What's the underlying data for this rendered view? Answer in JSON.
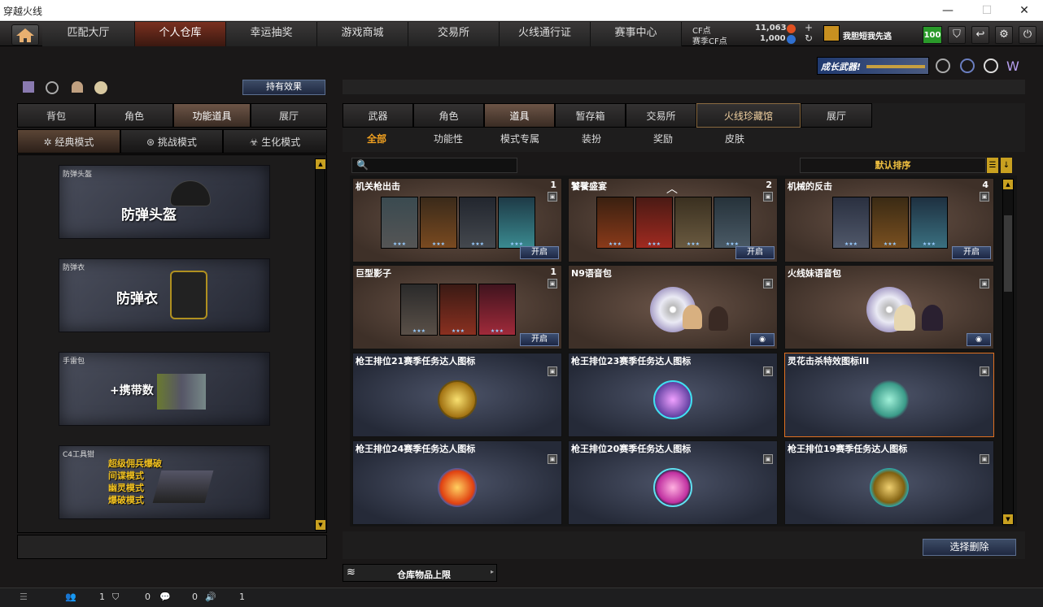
{
  "window": {
    "title": "穿越火线",
    "min": "—",
    "max": "☐",
    "close": "✕"
  },
  "nav": {
    "tabs": [
      "匹配大厅",
      "个人仓库",
      "幸运抽奖",
      "游戏商城",
      "交易所",
      "火线通行证",
      "赛事中心"
    ],
    "active_index": 1
  },
  "currency": {
    "cf_label": "CF点",
    "cf_value": "11,063",
    "season_label": "赛季CF点",
    "season_value": "1,000"
  },
  "user": {
    "name": "我胆短我先逃",
    "level": "100"
  },
  "banner": {
    "text": "成长武器!"
  },
  "left": {
    "effects_button": "持有效果",
    "tabs": [
      "背包",
      "角色",
      "功能道具",
      "展厅"
    ],
    "active_tab": 2,
    "modes": [
      "经典模式",
      "挑战模式",
      "生化模式"
    ],
    "active_mode": 0,
    "slots": [
      {
        "label": "防弹头盔",
        "title": "防弹头盔"
      },
      {
        "label": "防弹衣",
        "title": "防弹衣"
      },
      {
        "label": "手雷包",
        "title": "+携带数"
      },
      {
        "label": "C4工具钳",
        "lines": [
          "超级佣兵爆破",
          "间谍模式",
          "幽灵模式",
          "爆破模式"
        ]
      }
    ]
  },
  "right": {
    "tabs": [
      "武器",
      "角色",
      "道具",
      "暂存箱",
      "交易所",
      "火线珍藏馆",
      "展厅"
    ],
    "active_tab": 2,
    "subtabs": [
      "全部",
      "功能性",
      "模式专属",
      "装扮",
      "奖励",
      "皮肤"
    ],
    "active_sub": 0,
    "search_placeholder": "",
    "sort": "默认排序",
    "cards": [
      {
        "name": "机关枪出击",
        "count": "1",
        "button": "开启"
      },
      {
        "name": "饕餮盛宴",
        "count": "2",
        "button": "开启"
      },
      {
        "name": "机械的反击",
        "count": "4",
        "button": "开启"
      },
      {
        "name": "巨型影子",
        "count": "1",
        "button": "开启"
      },
      {
        "name": "N9语音包",
        "count": ""
      },
      {
        "name": "火线妹语音包",
        "count": ""
      },
      {
        "name": "枪王排位21赛季任务达人图标",
        "count": ""
      },
      {
        "name": "枪王排位23赛季任务达人图标",
        "count": ""
      },
      {
        "name": "灵花击杀特效图标III",
        "count": ""
      },
      {
        "name": "枪王排位24赛季任务达人图标",
        "count": ""
      },
      {
        "name": "枪王排位20赛季任务达人图标",
        "count": ""
      },
      {
        "name": "枪王排位19赛季任务达人图标",
        "count": ""
      }
    ],
    "delete_button": "选择删除",
    "capacity_label": "仓库物品上限"
  },
  "status": {
    "v1": "1",
    "v2": "0",
    "v3": "0",
    "v4": "1"
  }
}
